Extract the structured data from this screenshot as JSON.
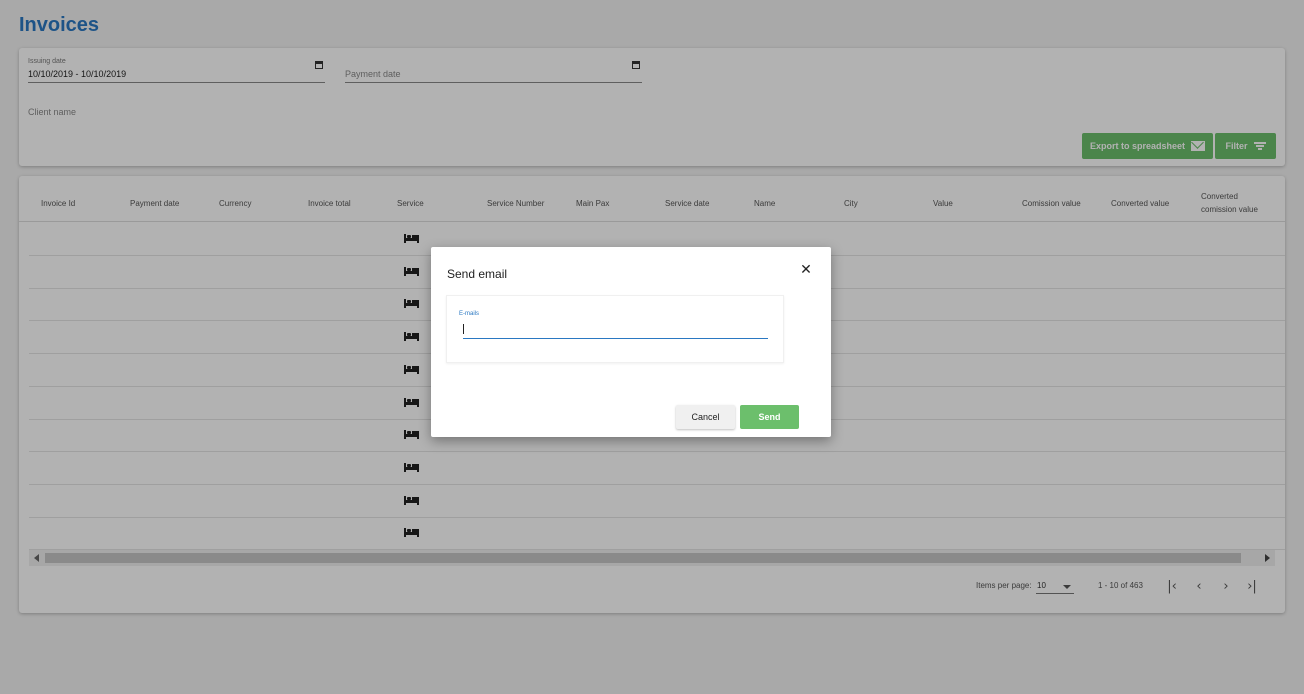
{
  "page": {
    "title": "Invoices"
  },
  "filters": {
    "issuing_date": {
      "label": "Issuing date",
      "value": "10/10/2019 - 10/10/2019"
    },
    "payment_date": {
      "placeholder": "Payment date"
    },
    "client_name": {
      "placeholder": "Client name"
    },
    "export_label": "Export to spreadsheet",
    "filter_label": "Filter"
  },
  "table": {
    "headers": {
      "invoice_id": "Invoice Id",
      "payment_date": "Payment date",
      "currency": "Currency",
      "invoice_total": "Invoice total",
      "service": "Service",
      "service_number": "Service Number",
      "main_pax": "Main Pax",
      "service_date": "Service date",
      "name": "Name",
      "city": "City",
      "value": "Value",
      "comission_value": "Comission value",
      "converted_value": "Converted value",
      "converted_comission_value_1": "Converted",
      "converted_comission_value_2": "comission value"
    },
    "rows": [
      {
        "service_icon": "bed-icon"
      },
      {
        "service_icon": "bed-icon"
      },
      {
        "service_icon": "bed-icon"
      },
      {
        "service_icon": "bed-icon"
      },
      {
        "service_icon": "bed-icon"
      },
      {
        "service_icon": "bed-icon"
      },
      {
        "service_icon": "bed-icon"
      },
      {
        "service_icon": "bed-icon"
      },
      {
        "service_icon": "bed-icon"
      },
      {
        "service_icon": "bed-icon"
      }
    ]
  },
  "pagination": {
    "items_per_page_label": "Items per page:",
    "items_per_page": "10",
    "range_label": "1 - 10 of 463"
  },
  "dialog": {
    "title": "Send email",
    "field_label": "E-mails",
    "cancel_label": "Cancel",
    "send_label": "Send"
  },
  "colors": {
    "accent": "#2a78c2",
    "primary_button": "#6cbf6c"
  }
}
